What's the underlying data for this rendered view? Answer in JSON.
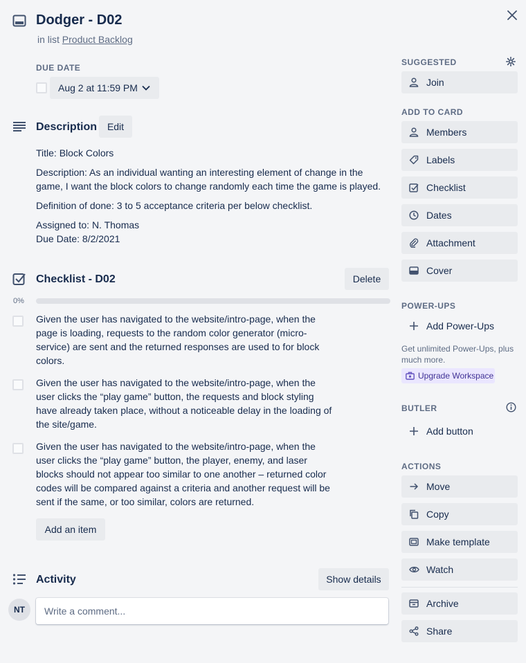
{
  "card": {
    "title": "Dodger - D02",
    "in_list_prefix": "in list",
    "list_name": "Product Backlog"
  },
  "due_date": {
    "label": "DUE DATE",
    "value": "Aug 2 at 11:59 PM"
  },
  "description": {
    "title": "Description",
    "edit_label": "Edit",
    "lines": [
      "Title: Block Colors",
      "Description: As an individual wanting an interesting element of change in the game, I want the block colors to change randomly each time the game is played.",
      "Definition of done: 3 to 5 acceptance criteria per below checklist.",
      "Assigned to: N. Thomas",
      "Due Date: 8/2/2021"
    ]
  },
  "checklist": {
    "title": "Checklist - D02",
    "delete_label": "Delete",
    "progress_text": "0%",
    "progress": 0,
    "items": [
      "Given the user has navigated to the website/intro-page, when the page is loading, requests to the random color generator (micro-service) are sent and the returned responses are used to for block colors.",
      "Given the user has navigated to the website/intro-page, when the user clicks the “play game” button, the requests and block styling have already taken place, without a noticeable delay in the loading of the site/game.",
      "Given the user has navigated to the website/intro-page, when the user clicks the “play game” button, the player, enemy, and laser blocks should not appear too similar to one another – returned color codes will be compared against a criteria and another request will be sent if the same, or too similar, colors are returned."
    ],
    "add_item_label": "Add an item"
  },
  "activity": {
    "title": "Activity",
    "show_details_label": "Show details",
    "avatar_initials": "NT",
    "comment_placeholder": "Write a comment..."
  },
  "sidebar": {
    "suggested": {
      "label": "SUGGESTED",
      "join": "Join"
    },
    "add_to_card": {
      "label": "ADD TO CARD",
      "members": "Members",
      "labels": "Labels",
      "checklist": "Checklist",
      "dates": "Dates",
      "attachment": "Attachment",
      "cover": "Cover"
    },
    "power_ups": {
      "label": "POWER-UPS",
      "add": "Add Power-Ups",
      "promo": "Get unlimited Power-Ups, plus much more.",
      "upgrade": "Upgrade Workspace"
    },
    "butler": {
      "label": "BUTLER",
      "add_button": "Add button"
    },
    "actions": {
      "label": "ACTIONS",
      "move": "Move",
      "copy": "Copy",
      "make_template": "Make template",
      "watch": "Watch",
      "archive": "Archive",
      "share": "Share"
    }
  },
  "colors": {
    "background": "#f4f5f7",
    "button": "#e9ebee",
    "text": "#172b4d",
    "muted": "#5e6c84",
    "upgrade_bg": "#eae6ff",
    "upgrade_text": "#403294",
    "progress_fill": "#5aac44"
  },
  "icons": {
    "card": "card-icon",
    "close": "close-icon",
    "description": "description-lines-icon",
    "checklist": "checkbox-icon",
    "activity": "activity-list-icon",
    "gear": "gear-icon",
    "info": "info-icon"
  }
}
